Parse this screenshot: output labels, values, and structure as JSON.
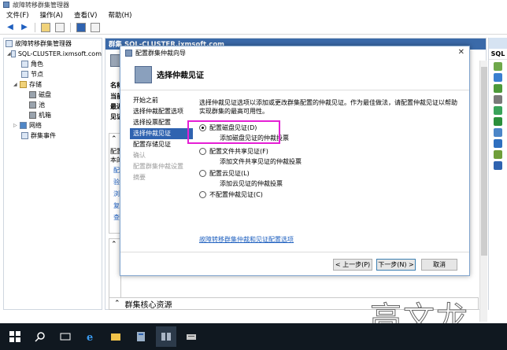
{
  "window": {
    "title": "故障转移群集管理器"
  },
  "menu": [
    "文件(F)",
    "操作(A)",
    "查看(V)",
    "帮助(H)"
  ],
  "tree": {
    "root": "故障转移群集管理器",
    "cluster": "SQL-CLUSTER.ixmsoft.com",
    "children": [
      "角色",
      "节点",
      "存储",
      "磁盘",
      "池",
      "机箱",
      "网络",
      "群集事件"
    ]
  },
  "center": {
    "header": "群集 SQL-CLUSTER.ixmsoft.com",
    "labels": [
      "名称:",
      "当前主",
      "最近的",
      "见证:"
    ],
    "left_fragments": [
      "配置特",
      "本的群",
      "配",
      "验",
      "浏",
      "复",
      "查"
    ],
    "section2_title": "导",
    "section3_title": "群集核心资源"
  },
  "actions": {
    "header": "SQL"
  },
  "dialog": {
    "title": "配置群集仲裁向导",
    "header": "选择仲裁见证",
    "close": "✕",
    "steps": [
      {
        "label": "开始之前",
        "state": "normal"
      },
      {
        "label": "选择仲裁配置选项",
        "state": "normal"
      },
      {
        "label": "选择投票配置",
        "state": "normal"
      },
      {
        "label": "选择仲裁见证",
        "state": "active"
      },
      {
        "label": "配置存储见证",
        "state": "normal"
      },
      {
        "label": "确认",
        "state": "disabled"
      },
      {
        "label": "配置群集仲裁设置",
        "state": "disabled"
      },
      {
        "label": "摘要",
        "state": "disabled"
      }
    ],
    "description": "选择仲裁见证选项以添加或更改群集配置的仲裁见证。作为最佳做法，请配置仲裁见证以帮助实现群集的最高可用性。",
    "options": [
      {
        "label": "配置磁盘见证(D)",
        "sub": "添加磁盘见证的仲裁投票",
        "checked": true
      },
      {
        "label": "配置文件共享见证(F)",
        "sub": "添加文件共享见证的仲裁投票",
        "checked": false
      },
      {
        "label": "配置云见证(L)",
        "sub": "添加云见证的仲裁投票",
        "checked": false
      },
      {
        "label": "不配置仲裁见证(C)",
        "sub": "",
        "checked": false
      }
    ],
    "link": "故障转移群集仲裁和见证配置选项",
    "buttons": {
      "prev": "< 上一步(P)",
      "next": "下一步(N) >",
      "cancel": "取消"
    }
  },
  "watermark": "高文龙",
  "colors": {
    "accent": "#2f63b0",
    "highlight": "#e51fd5",
    "taskbar": "#101820"
  }
}
